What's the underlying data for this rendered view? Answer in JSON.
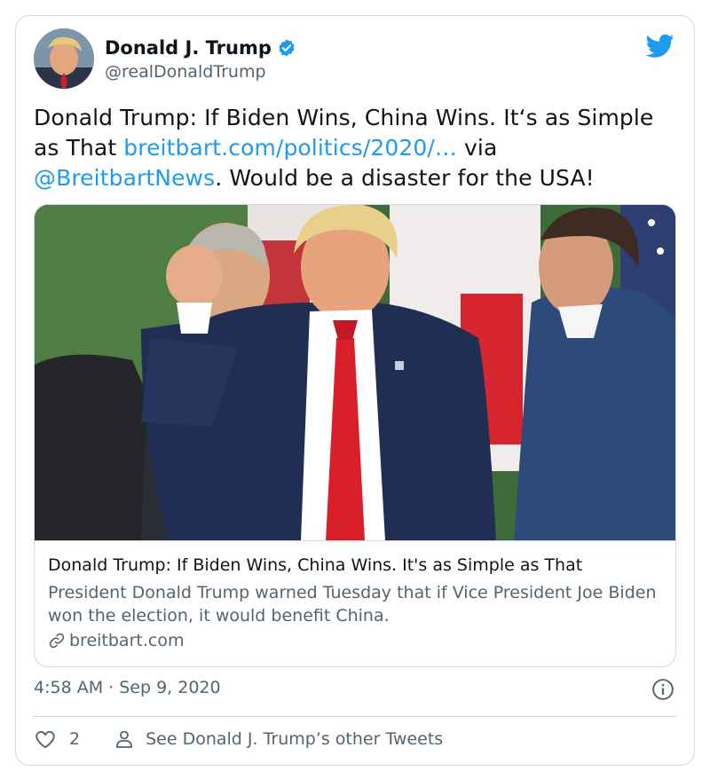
{
  "author": {
    "display_name": "Donald J. Trump",
    "handle": "@realDonaldTrump",
    "verified": true
  },
  "tweet": {
    "text_before_link": "Donald Trump: If Biden Wins, China Wins. It‘s as Simple as That ",
    "link_text": "breitbart.com/politics/2020/…",
    "text_via": " via ",
    "mention": "@BreitbartNews",
    "text_after": ". Would be a disaster for the USA!"
  },
  "link_card": {
    "title": "Donald Trump: If Biden Wins, China Wins. It's as Simple as That",
    "description": "President Donald Trump warned Tuesday that if Vice President Joe Biden won the election, it would benefit China.",
    "domain": "breitbart.com"
  },
  "timestamp": "4:58 AM · Sep 9, 2020",
  "actions": {
    "like_count": "2",
    "see_other_label": "See Donald J. Trump’s other Tweets"
  },
  "colors": {
    "accent": "#1d9bf0",
    "text_primary": "#0f1419",
    "text_secondary": "#536471",
    "border": "#cfd9de"
  },
  "icons": [
    "verified-badge-icon",
    "twitter-bird-icon",
    "link-icon",
    "info-icon",
    "heart-icon",
    "person-icon"
  ]
}
